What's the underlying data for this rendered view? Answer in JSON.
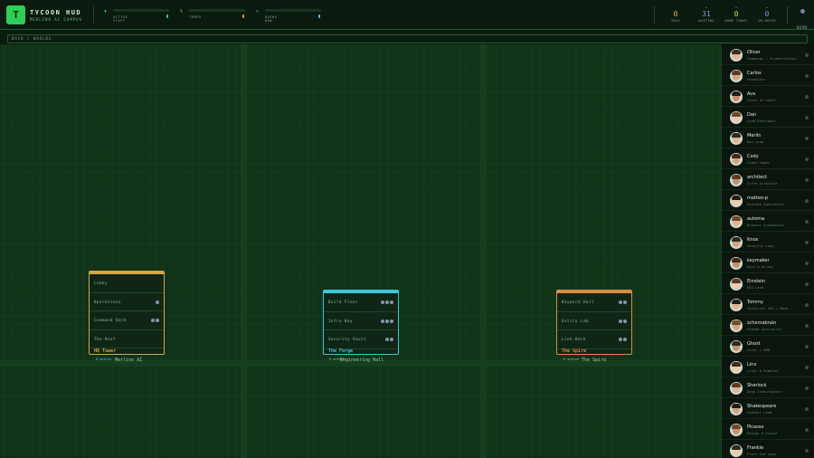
{
  "brand": {
    "logo_letter": "T",
    "title": "TYCOON HUD",
    "subtitle": "MERLINO AI CAMPUS"
  },
  "meters": [
    {
      "glyph": "♦",
      "label": "ACTIVE STAFF",
      "value": 0.95,
      "color": "#3fd067"
    },
    {
      "glyph": "%",
      "label": "TEMPO",
      "value": 0.95,
      "color": "#e0a043"
    },
    {
      "glyph": ">",
      "label": "DOING NOW",
      "value": 0.95,
      "color": "#68b6e8"
    }
  ],
  "stats": [
    {
      "tick": "-",
      "value": "0",
      "label": "IDLE",
      "color": "#e8b43e"
    },
    {
      "tick": "•",
      "value": "31",
      "label": "WAITING",
      "color": "#7ea0c6"
    },
    {
      "tick": "•",
      "value": "0",
      "label": "DONE TODAY",
      "color": "#d9d36a"
    },
    {
      "tick": "•",
      "value": "0",
      "label": "IN QUEUE",
      "color": "#8e88d8"
    }
  ],
  "demo_label": "DEMO",
  "breadcrumb": "BACK / WORLDS",
  "buildings": [
    {
      "name": "HQ Tower",
      "caption": "Merlino AI",
      "badge": "8 active",
      "accent": "gold",
      "floors": [
        {
          "label": "Lobby",
          "dots": 0
        },
        {
          "label": "Operations",
          "dots": 1
        },
        {
          "label": "Command Deck",
          "dots": 2
        },
        {
          "label": "The Roof",
          "dots": 0
        }
      ]
    },
    {
      "name": "The Forge",
      "caption": "Engineering Hall",
      "badge": "9 active",
      "accent": "cyan",
      "floors": [
        {
          "label": "Build Floor",
          "dots": 3
        },
        {
          "label": "Infra Bay",
          "dots": 3
        },
        {
          "label": "Security Vault",
          "dots": 2
        }
      ]
    },
    {
      "name": "The Spire",
      "caption": "The Spire",
      "badge": "6 active",
      "accent": "orange",
      "floors": [
        {
          "label": "Keyword Hall",
          "dots": 2
        },
        {
          "label": "Entity Lab",
          "dots": 2
        },
        {
          "label": "Link Deck",
          "dots": 2
        }
      ]
    }
  ],
  "agents": [
    {
      "name": "Oliver",
      "role": "Campaign / Orchestration"
    },
    {
      "name": "Carlos",
      "role": "Conductor"
    },
    {
      "name": "Ava",
      "role": "Chief of Staff"
    },
    {
      "name": "Dan",
      "role": "Lead Developer"
    },
    {
      "name": "Merlin",
      "role": "Dev Lead"
    },
    {
      "name": "Cody",
      "role": "Codex Coder"
    },
    {
      "name": "architect",
      "role": "Infra Architect"
    },
    {
      "name": "matteo-p",
      "role": "Runtime Specialist"
    },
    {
      "name": "automa",
      "role": "Browser Automation"
    },
    {
      "name": "Knox",
      "role": "Security Lead"
    },
    {
      "name": "keymaker",
      "role": "Keys & Access"
    },
    {
      "name": "Einstein",
      "role": "SEO Lead"
    },
    {
      "name": "Tommy",
      "role": "Technical SEO + Data"
    },
    {
      "name": "schemabrain",
      "role": "Schema Specialist"
    },
    {
      "name": "Ghost",
      "role": "Local / GMB"
    },
    {
      "name": "Linx",
      "role": "Links & Domains"
    },
    {
      "name": "Sherlock",
      "role": "Deep Investigator"
    },
    {
      "name": "Shakespeare",
      "role": "Content Lead"
    },
    {
      "name": "Picasso",
      "role": "Design & Visual"
    },
    {
      "name": "Frankie",
      "role": "Front-End Lead"
    }
  ]
}
